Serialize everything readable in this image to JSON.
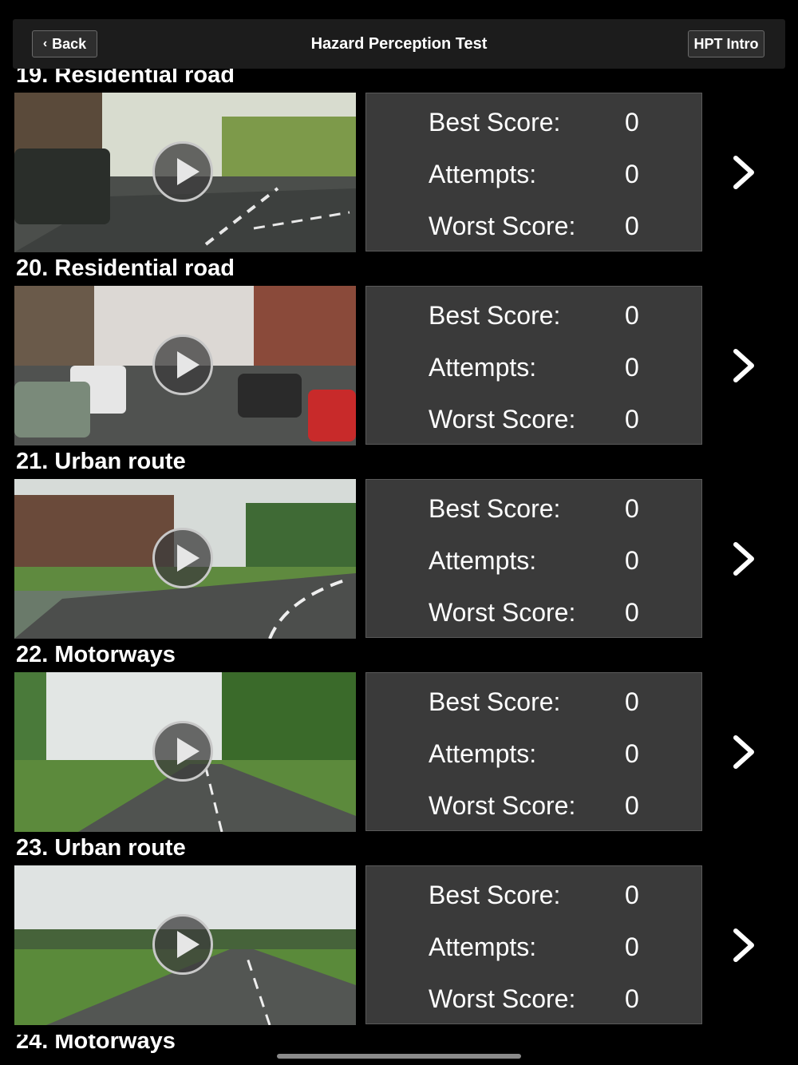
{
  "header": {
    "back_label": "Back",
    "title": "Hazard Perception Test",
    "intro_label": "HPT Intro"
  },
  "stat_labels": {
    "best": "Best Score:",
    "attempts": "Attempts:",
    "worst": "Worst Score:"
  },
  "items": [
    {
      "title": "19. Residential road",
      "best": "0",
      "attempts": "0",
      "worst": "0"
    },
    {
      "title": "20. Residential road",
      "best": "0",
      "attempts": "0",
      "worst": "0"
    },
    {
      "title": "21. Urban route",
      "best": "0",
      "attempts": "0",
      "worst": "0"
    },
    {
      "title": "22. Motorways",
      "best": "0",
      "attempts": "0",
      "worst": "0"
    },
    {
      "title": "23. Urban route",
      "best": "0",
      "attempts": "0",
      "worst": "0"
    },
    {
      "title": "24. Motorways"
    }
  ],
  "icons": {
    "play": "play-icon",
    "chevron": "chevron-right-icon",
    "back": "chevron-left-icon"
  }
}
